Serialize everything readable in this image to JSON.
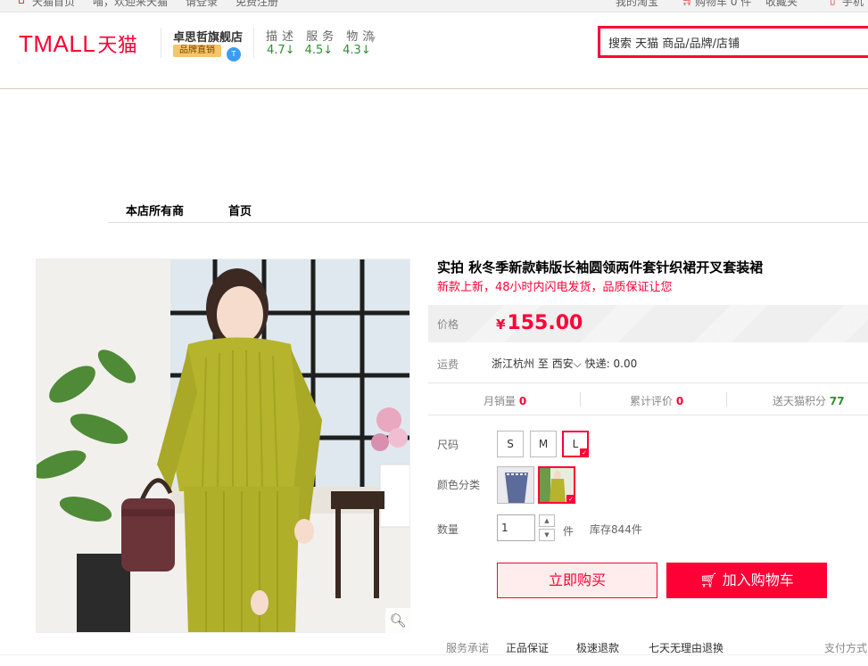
{
  "topbar": {
    "home": "天猫首页",
    "welcome": "喵，欢迎来天猫",
    "login": "请登录",
    "register": "免费注册",
    "my_taobao": "我的淘宝",
    "cart": "购物车 0 件",
    "favorites": "收藏夹",
    "mobile": "手机"
  },
  "header": {
    "logo_text": "TMALL",
    "logo_cn": "天猫",
    "shop_name": "卓思哲旗舰店",
    "brand_tag": "品牌直销",
    "dsr_label": "描述 服务 物流",
    "dsr_scores": [
      "4.7↓",
      "4.5↓",
      "4.3↓"
    ],
    "search_value": "搜索 天猫 商品/品牌/店铺"
  },
  "nav": {
    "items": [
      "本店所有商",
      "首页"
    ]
  },
  "product": {
    "title": "实拍 秋冬季新款韩版长袖圆领两件套针织裙开叉套装裙",
    "subtitle": "新款上新，48小时内闪电发货，品质保证让您",
    "price_label": "价格",
    "currency": "¥",
    "price": "155.00",
    "shipping_label": "运费",
    "ship_from": "浙江杭州",
    "ship_to_prefix": "至",
    "ship_to": "西安",
    "express": "快递: 0.00",
    "stats": {
      "monthly_sales_label": "月销量",
      "monthly_sales": "0",
      "reviews_label": "累计评价",
      "reviews": "0",
      "points_label": "送天猫积分",
      "points": "77"
    },
    "size_label": "尺码",
    "sizes": [
      "S",
      "M",
      "L"
    ],
    "selected_size": "L",
    "color_label": "颜色分类",
    "quantity_label": "数量",
    "quantity": "1",
    "unit": "件",
    "stock": "库存844件",
    "buy_now": "立即购买",
    "add_cart": "加入购物车"
  },
  "promise": {
    "label": "服务承诺",
    "items": [
      "正品保证",
      "极速退款",
      "七天无理由退换"
    ],
    "payment": "支付方式"
  },
  "colors": {
    "tmall_red": "#ff0036",
    "dsr_green": "#2f8f2f",
    "sweater_green": "#b5b42c"
  }
}
